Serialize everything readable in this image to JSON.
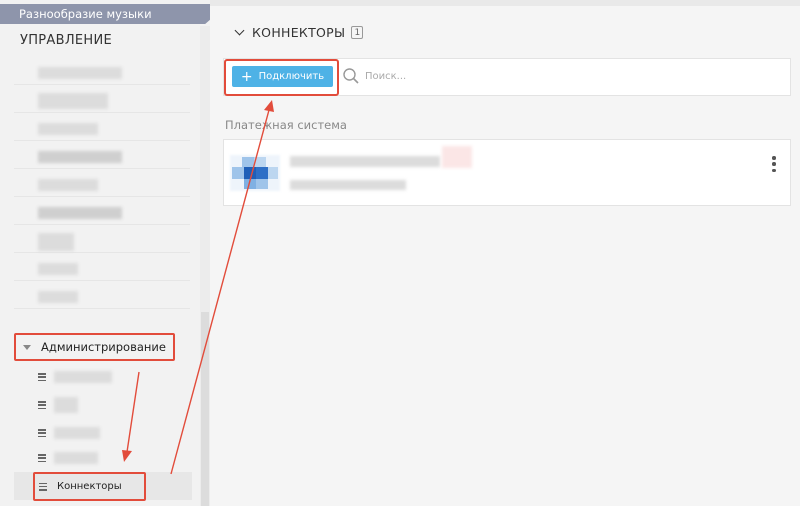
{
  "sidebar": {
    "org_tab_label": "Разнообразие музыки",
    "section_title": "УПРАВЛЕНИЕ",
    "admin_label": "Администрирование",
    "connectors_label": "Коннекторы"
  },
  "main": {
    "heading": "КОННЕКТОРЫ",
    "count": "1",
    "connect_button": "Подключить",
    "search": {
      "placeholder": "Поиск...",
      "value": ""
    },
    "group_title": "Платежная система"
  },
  "icons": {
    "admin_toggle": "caret-down-icon",
    "collapse": "chevron-down-icon",
    "list": "list-icon",
    "search": "search-icon",
    "plus": "plus-icon",
    "more": "kebab-menu-icon"
  },
  "colors": {
    "accent": "#4eb2e6",
    "annotation": "#e24c3b",
    "tab": "#8e95ab",
    "logo_primary": "#1f5fb8",
    "logo_secondary": "#9fc4ea"
  }
}
